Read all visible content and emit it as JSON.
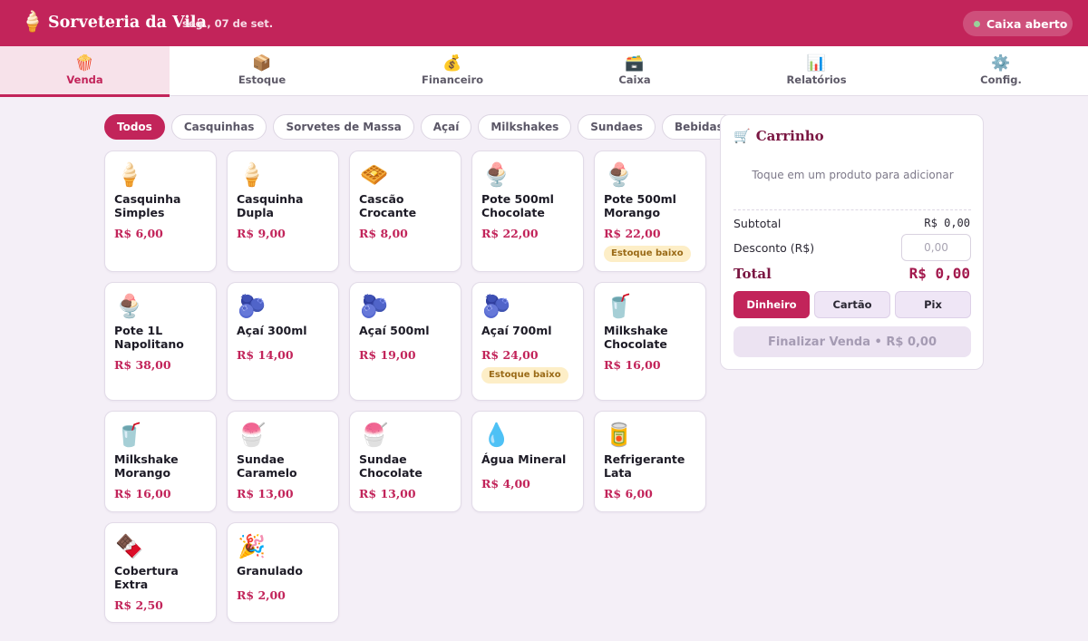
{
  "header": {
    "icon": "🍦",
    "title": "Sorveteria da Vila",
    "date": "seg., 07 de set.",
    "cash_status": "Caixa aberto",
    "cash_status_color": "#9ad19a",
    "brand_color": "#c2245a"
  },
  "nav": {
    "tabs": [
      {
        "icon": "🍿",
        "label": "Venda",
        "active": true
      },
      {
        "icon": "📦",
        "label": "Estoque"
      },
      {
        "icon": "💰",
        "label": "Financeiro"
      },
      {
        "icon": "🗃️",
        "label": "Caixa"
      },
      {
        "icon": "📊",
        "label": "Relatórios"
      },
      {
        "icon": "⚙️",
        "label": "Config."
      }
    ]
  },
  "filters": [
    "Todos",
    "Casquinhas",
    "Sorvetes de Massa",
    "Açaí",
    "Milkshakes",
    "Sundaes",
    "Bebidas"
  ],
  "products": [
    {
      "icon": "🍦",
      "name": "Casquinha Simples",
      "price": "R$ 6,00"
    },
    {
      "icon": "🍦",
      "name": "Casquinha Dupla",
      "price": "R$ 9,00"
    },
    {
      "icon": "🧇",
      "name": "Cascão Crocante",
      "price": "R$ 8,00"
    },
    {
      "icon": "🍨",
      "name": "Pote 500ml Chocolate",
      "price": "R$ 22,00"
    },
    {
      "icon": "🍨",
      "name": "Pote 500ml Morango",
      "price": "R$ 22,00",
      "badge": "Estoque baixo"
    },
    {
      "icon": "🍨",
      "name": "Pote 1L Napolitano",
      "price": "R$ 38,00"
    },
    {
      "icon": "🫐",
      "name": "Açaí 300ml",
      "price": "R$ 14,00"
    },
    {
      "icon": "🫐",
      "name": "Açaí 500ml",
      "price": "R$ 19,00"
    },
    {
      "icon": "🫐",
      "name": "Açaí 700ml",
      "price": "R$ 24,00",
      "badge": "Estoque baixo"
    },
    {
      "icon": "🥤",
      "name": "Milkshake Chocolate",
      "price": "R$ 16,00"
    },
    {
      "icon": "🥤",
      "name": "Milkshake Morango",
      "price": "R$ 16,00"
    },
    {
      "icon": "🍧",
      "name": "Sundae Caramelo",
      "price": "R$ 13,00"
    },
    {
      "icon": "🍧",
      "name": "Sundae Chocolate",
      "price": "R$ 13,00"
    },
    {
      "icon": "💧",
      "name": "Água Mineral",
      "price": "R$ 4,00"
    },
    {
      "icon": "🥫",
      "name": "Refrigerante Lata",
      "price": "R$ 6,00"
    },
    {
      "icon": "🍫",
      "name": "Cobertura Extra",
      "price": "R$ 2,50"
    },
    {
      "icon": "🎉",
      "name": "Granulado",
      "price": "R$ 2,00"
    }
  ],
  "cart": {
    "icon": "🛒",
    "title": "Carrinho",
    "empty_message": "Toque em um produto para adicionar",
    "subtotal_label": "Subtotal",
    "subtotal_value": "R$ 0,00",
    "discount_label": "Desconto (R$)",
    "discount_placeholder": "0,00",
    "total_label": "Total",
    "total_value": "R$ 0,00",
    "payment_methods": [
      "Dinheiro",
      "Cartão",
      "Pix"
    ],
    "selected_payment": "Dinheiro",
    "finalize_label": "Finalizar Venda • R$ 0,00"
  }
}
